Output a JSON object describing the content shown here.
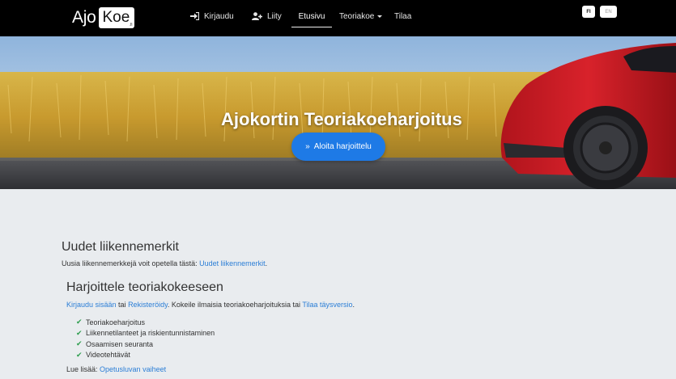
{
  "navbar": {
    "logo_ajo": "Ajo",
    "logo_koe": "Koe",
    "logo_fi": ".fi",
    "login": "Kirjaudu",
    "join": "Liity",
    "home": "Etusivu",
    "theory": "Teoriakoe",
    "order": "Tilaa",
    "lang_fi": "FI",
    "lang_en": "EN"
  },
  "hero": {
    "title": "Ajokortin Teoriakoeharjoitus",
    "start_button": "Aloita harjoittelu"
  },
  "signs": {
    "heading": "Uudet liikennemerkit",
    "text": "Uusia liikennemerkkejä voit opetella tästä: ",
    "link": "Uudet liikennemerkit",
    "text_end": "."
  },
  "practice": {
    "heading": "Harjoittele teoriakokeeseen",
    "login_link": "Kirjaudu sisään",
    "or": " tai ",
    "register_link": "Rekisteröidy",
    "text": ". Kokeile ilmaisia teoriakoeharjoituksia tai ",
    "order_link": "Tilaa täysversio",
    "text_end": ".",
    "features": [
      "Teoriakoeharjoitus",
      "Liikennetilanteet ja riskientunnistaminen",
      "Osaamisen seuranta",
      "Videotehtävät"
    ],
    "more_label": "Lue lisää: ",
    "more_link": "Opetusluvan vaiheet"
  }
}
